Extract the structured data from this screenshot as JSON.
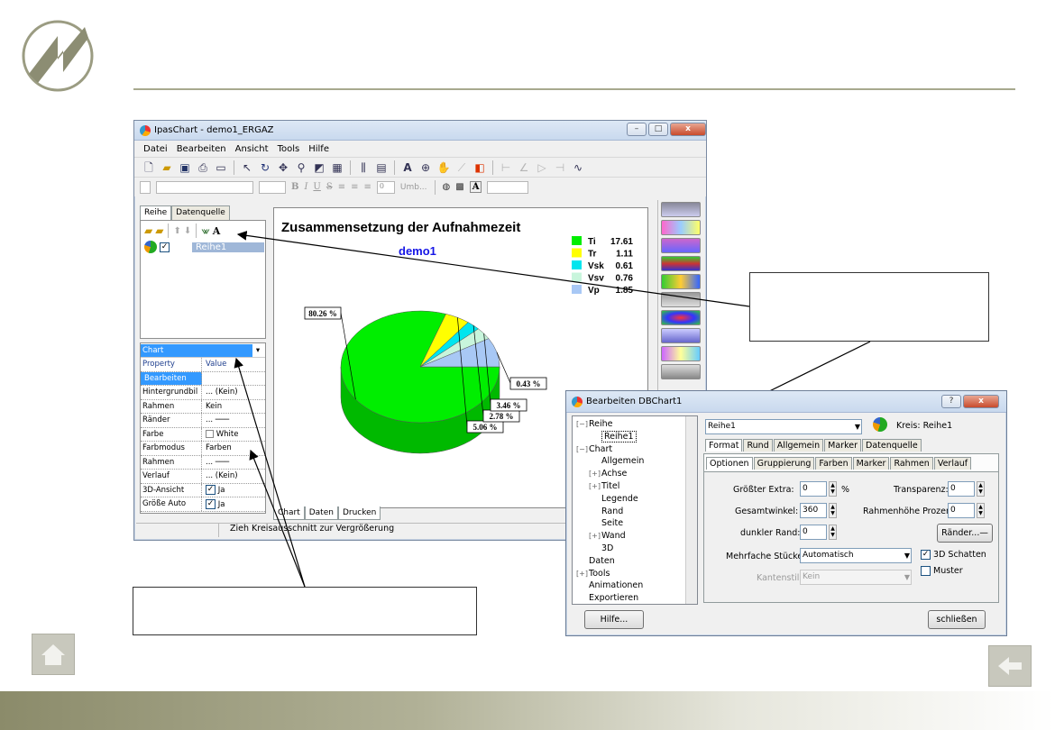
{
  "colors": {
    "accent": "#a7a98e",
    "pie_green": "#00ee00",
    "highlight": "#3399ff"
  },
  "window": {
    "title": "IpasChart - demo1_ERGAZ",
    "menu": [
      "Datei",
      "Bearbeiten",
      "Ansicht",
      "Tools",
      "Hilfe"
    ],
    "toolbar_icons": [
      "new-icon",
      "open-icon",
      "save-icon",
      "print-icon",
      "print-preview-icon",
      "select-icon",
      "rotate-icon",
      "move-icon",
      "zoom-icon",
      "3d-icon",
      "grid-icon",
      "edit-series-icon",
      "data-icon",
      "font-icon",
      "zoom-in-icon",
      "hand-icon",
      "draw-line-icon",
      "color-icon"
    ],
    "format_bar": {
      "font_size": "0",
      "wrap_label": "Umb..."
    },
    "left_tabs": [
      "Reihe",
      "Datenquelle"
    ],
    "series": [
      {
        "name": "Reihe1",
        "checked": true
      }
    ],
    "prop_selected": "Chart",
    "prop_headers": [
      "Property",
      "Value"
    ],
    "props": [
      {
        "k": "Bearbeiten",
        "v": ""
      },
      {
        "k": "Hintergrundbil",
        "v": "...  (Kein)"
      },
      {
        "k": "Rahmen",
        "v": "Kein"
      },
      {
        "k": "Ränder",
        "v": "..."
      },
      {
        "k": "Farbe",
        "v": "White"
      },
      {
        "k": "Farbmodus",
        "v": "Farben"
      },
      {
        "k": "Rahmen",
        "v": "..."
      },
      {
        "k": "Verlauf",
        "v": "...  (Kein)"
      },
      {
        "k": "3D-Ansicht",
        "v": "Ja"
      },
      {
        "k": "Größe Auto",
        "v": "Ja"
      }
    ],
    "bottom_tabs": [
      "Chart",
      "Daten",
      "Drucken"
    ],
    "status": "Zieh Kreisausschnitt zur Vergrößerung"
  },
  "chart_data": {
    "type": "pie",
    "title": "Zusammensetzung der Aufnahmezeit",
    "subtitle": "demo1",
    "categories": [
      "Ti",
      "Tr",
      "Vsk",
      "Vsv",
      "Vp"
    ],
    "values": [
      17.61,
      1.11,
      0.61,
      0.76,
      1.85
    ],
    "value_labels": [
      "17.61",
      "1.11",
      "0.61",
      "0.76",
      "1.85"
    ],
    "percent_labels": [
      "80.26 %",
      "5.06 %",
      "2.78 %",
      "3.46 %",
      "0.43 %"
    ],
    "colors": [
      "#00ee00",
      "#ffff00",
      "#00e5ee",
      "#c8f5dc",
      "#a8c8f5"
    ],
    "legend_position": "top-right",
    "three_d": true
  },
  "dialog": {
    "title": "Bearbeiten DBChart1",
    "tree": [
      {
        "label": "Reihe",
        "indent": 0,
        "sign": "−"
      },
      {
        "label": "Reihe1",
        "indent": 1,
        "sign": "",
        "selected": true
      },
      {
        "label": "Chart",
        "indent": 0,
        "sign": "−"
      },
      {
        "label": "Allgemein",
        "indent": 1,
        "sign": ""
      },
      {
        "label": "Achse",
        "indent": 1,
        "sign": "+"
      },
      {
        "label": "Titel",
        "indent": 1,
        "sign": "+"
      },
      {
        "label": "Legende",
        "indent": 1,
        "sign": ""
      },
      {
        "label": "Rand",
        "indent": 1,
        "sign": ""
      },
      {
        "label": "Seite",
        "indent": 1,
        "sign": ""
      },
      {
        "label": "Wand",
        "indent": 1,
        "sign": "+"
      },
      {
        "label": "3D",
        "indent": 1,
        "sign": ""
      },
      {
        "label": "Daten",
        "indent": 0,
        "sign": ""
      },
      {
        "label": "Tools",
        "indent": 0,
        "sign": "+"
      },
      {
        "label": "Animationen",
        "indent": 0,
        "sign": ""
      },
      {
        "label": "Exportieren",
        "indent": 0,
        "sign": ""
      }
    ],
    "series_select": "Reihe1",
    "series_caption": "Kreis: Reihe1",
    "tabs1": [
      "Format",
      "Rund",
      "Allgemein",
      "Marker",
      "Datenquelle"
    ],
    "tabs2": [
      "Optionen",
      "Gruppierung",
      "Farben",
      "Marker",
      "Rahmen",
      "Verlauf"
    ],
    "fields": {
      "groesster_extra_label": "Größter Extra:",
      "groesster_extra": "0",
      "percent": "%",
      "transparenz_label": "Transparenz:",
      "transparenz": "0",
      "gesamtwinkel_label": "Gesamtwinkel:",
      "gesamtwinkel": "360",
      "rahmenhoehe_label": "Rahmenhöhe Prozent:",
      "rahmenhoehe": "0",
      "dunkler_rand_label": "dunkler Rand:",
      "dunkler_rand": "0",
      "raender_button": "Ränder...",
      "mehrfache_label": "Mehrfache Stücke:",
      "mehrfache": "Automatisch",
      "schatten_label": "3D Schatten",
      "kantenstil_label": "Kantenstil:",
      "kantenstil": "Kein",
      "muster_label": "Muster"
    },
    "help_button": "Hilfe...",
    "close_button": "schließen"
  }
}
